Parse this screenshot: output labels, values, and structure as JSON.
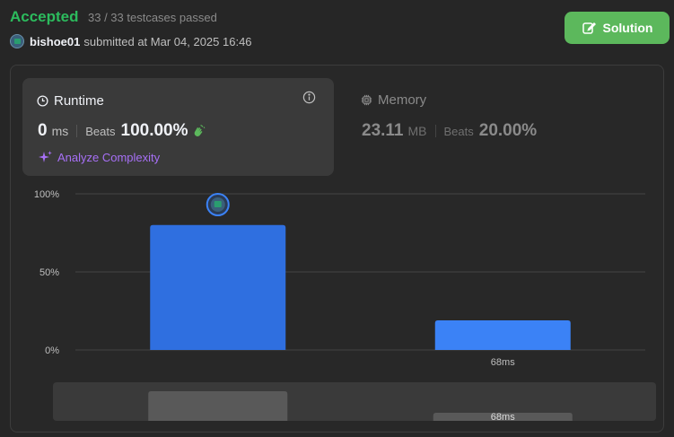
{
  "header": {
    "status": "Accepted",
    "testcases": "33 / 33 testcases passed",
    "username": "bishoe01",
    "submitted_text": "submitted at Mar 04, 2025 16:46",
    "solution_label": "Solution"
  },
  "runtime": {
    "title": "Runtime",
    "value": "0",
    "unit": "ms",
    "beats_label": "Beats",
    "beats_value": "100.00%",
    "analyze_label": "Analyze Complexity"
  },
  "memory": {
    "title": "Memory",
    "value": "23.11",
    "unit": "MB",
    "beats_label": "Beats",
    "beats_value": "20.00%"
  },
  "colors": {
    "accepted": "#2cbb5d",
    "solution_button": "#5cb85c",
    "bar": "#2f6fe0",
    "analyze": "#a770f6"
  },
  "chart_data": {
    "type": "bar",
    "categories": [
      "",
      "68ms"
    ],
    "values": [
      80,
      19
    ],
    "yticks": [
      0,
      50,
      100
    ],
    "ytick_labels": [
      "0%",
      "50%",
      "100%"
    ],
    "ylim": [
      0,
      100
    ],
    "grid": true,
    "highlight_category_index": 0,
    "overview": {
      "values": [
        80,
        19
      ],
      "labels": [
        "",
        "68ms"
      ]
    }
  }
}
